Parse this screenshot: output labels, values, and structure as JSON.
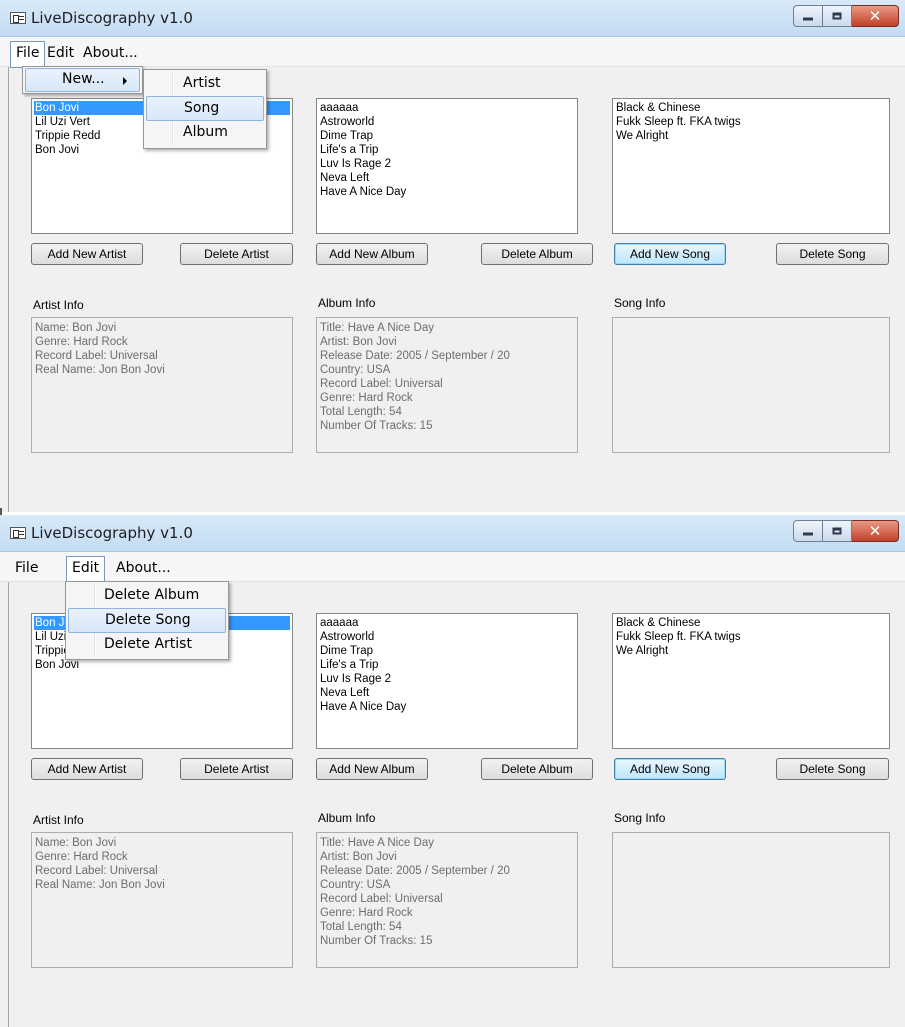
{
  "windows": [
    {
      "title": "LiveDiscography v1.0",
      "menus": [
        "File",
        "Edit",
        "About..."
      ],
      "artists": [
        "Bon Jovi",
        "Lil Uzi Vert",
        "Trippie Redd",
        "Bon Jovi"
      ],
      "albums": [
        "aaaaaa",
        "Astroworld",
        "Dime Trap",
        "Life's a Trip",
        "Luv Is Rage 2",
        "Neva Left",
        "Have A Nice Day"
      ],
      "songs": [
        "Black & Chinese",
        "Fukk Sleep ft. FKA twigs",
        "We Alright"
      ],
      "buttons": {
        "add_artist": "Add New Artist",
        "delete_artist": "Delete Artist",
        "add_album": "Add New Album",
        "delete_album": "Delete Album",
        "add_song": "Add New Song",
        "delete_song": "Delete Song"
      },
      "labels": {
        "artist_info": "Artist Info",
        "album_info": "Album Info",
        "song_info": "Song Info"
      },
      "artist_info": [
        "Name: Bon Jovi",
        "Genre: Hard Rock",
        "Record Label: Universal",
        "Real Name: Jon Bon Jovi"
      ],
      "album_info": [
        "Title: Have A Nice Day",
        "Artist: Bon Jovi",
        "Release Date: 2005 / September / 20",
        "Country: USA",
        "Record Label: Universal",
        "Genre: Hard Rock",
        "Total Length: 54",
        "Number Of Tracks: 15"
      ],
      "dropdown": {
        "new_label": "New...",
        "submenu": [
          "Artist",
          "Song",
          "Album"
        ],
        "highlighted": "Song"
      }
    },
    {
      "title": "LiveDiscography v1.0",
      "menus": [
        "File",
        "Edit",
        "About..."
      ],
      "artists": [
        "Bon Jovi",
        "Lil Uzi Vert",
        "Trippie Redd",
        "Bon Jovi"
      ],
      "albums": [
        "aaaaaa",
        "Astroworld",
        "Dime Trap",
        "Life's a Trip",
        "Luv Is Rage 2",
        "Neva Left",
        "Have A Nice Day"
      ],
      "songs": [
        "Black & Chinese",
        "Fukk Sleep ft. FKA twigs",
        "We Alright"
      ],
      "buttons": {
        "add_artist": "Add New Artist",
        "delete_artist": "Delete Artist",
        "add_album": "Add New Album",
        "delete_album": "Delete Album",
        "add_song": "Add New Song",
        "delete_song": "Delete Song"
      },
      "labels": {
        "artist_info": "Artist Info",
        "album_info": "Album Info",
        "song_info": "Song Info"
      },
      "artist_info": [
        "Name: Bon Jovi",
        "Genre: Hard Rock",
        "Record Label: Universal",
        "Real Name: Jon Bon Jovi"
      ],
      "album_info": [
        "Title: Have A Nice Day",
        "Artist: Bon Jovi",
        "Release Date: 2005 / September / 20",
        "Country: USA",
        "Record Label: Universal",
        "Genre: Hard Rock",
        "Total Length: 54",
        "Number Of Tracks: 15"
      ],
      "dropdown": {
        "items": [
          "Delete Album",
          "Delete Song",
          "Delete Artist"
        ],
        "highlighted": "Delete Song",
        "truncated_artists": [
          "Bon J",
          "Lil Uzi",
          "Trippi"
        ]
      }
    }
  ],
  "icons": {
    "app": "app-icon",
    "minimize": "minimize-icon",
    "maximize": "maximize-icon",
    "close": "close-icon",
    "submenu_arrow": "chevron-right-icon"
  },
  "colors": {
    "selection": "#3399ff",
    "title_gradient": "#c3dcf3",
    "close_button": "#c2412a"
  }
}
